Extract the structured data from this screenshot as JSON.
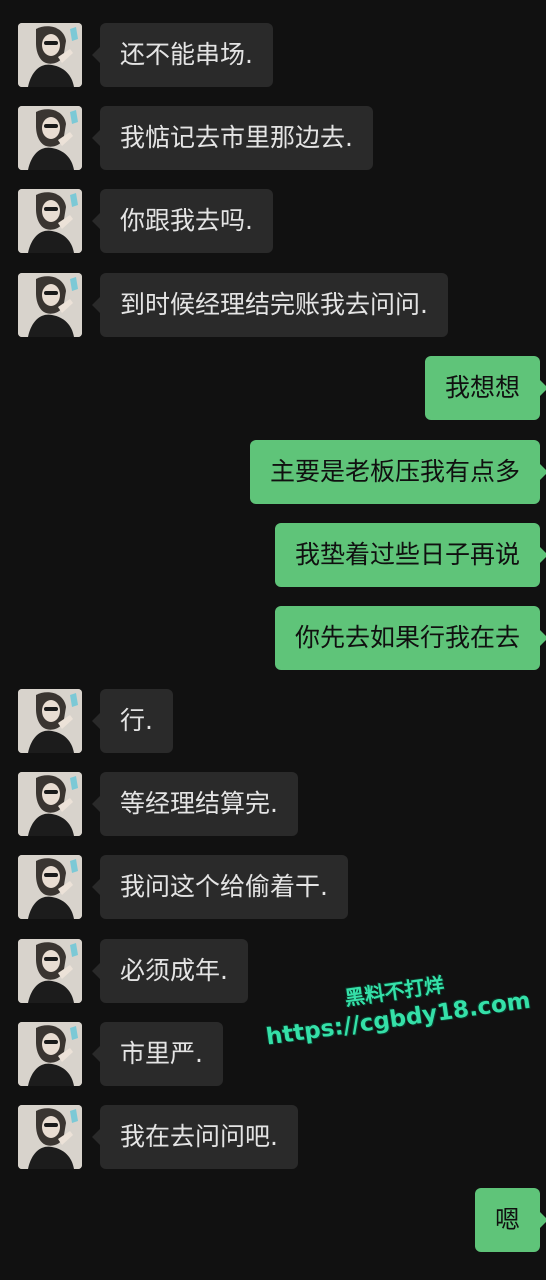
{
  "messages": [
    {
      "side": "in",
      "text": "还不能串场."
    },
    {
      "side": "in",
      "text": "我惦记去市里那边去."
    },
    {
      "side": "in",
      "text": "你跟我去吗."
    },
    {
      "side": "in",
      "text": "到时候经理结完账我去问问."
    },
    {
      "side": "out",
      "text": "我想想"
    },
    {
      "side": "out",
      "text": "主要是老板压我有点多"
    },
    {
      "side": "out",
      "text": "我垫着过些日子再说"
    },
    {
      "side": "out",
      "text": "你先去如果行我在去"
    },
    {
      "side": "in",
      "text": "行."
    },
    {
      "side": "in",
      "text": "等经理结算完."
    },
    {
      "side": "in",
      "text": "我问这个给偷着干."
    },
    {
      "side": "in",
      "text": "必须成年."
    },
    {
      "side": "in",
      "text": "市里严."
    },
    {
      "side": "in",
      "text": "我在去问问吧."
    },
    {
      "side": "out",
      "text": "嗯"
    }
  ],
  "watermark": {
    "line1": "黑料不打烊",
    "line2": "https://cgbdy18.com"
  },
  "colors": {
    "background": "#111111",
    "incoming_bubble": "#2a2a2a",
    "outgoing_bubble": "#5fc479",
    "watermark": "#35e0a8"
  }
}
